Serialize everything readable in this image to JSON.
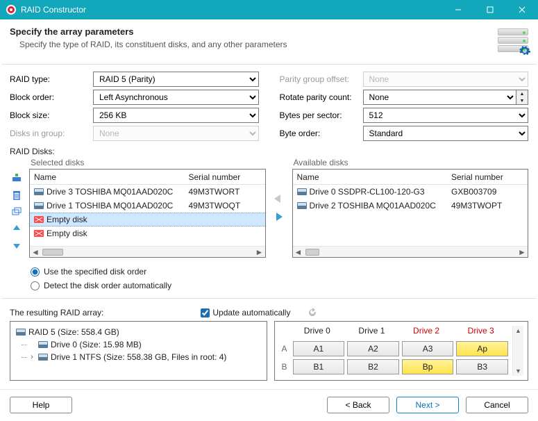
{
  "window": {
    "title": "RAID Constructor"
  },
  "header": {
    "title": "Specify the array parameters",
    "subtitle": "Specify the type of RAID, its constituent disks, and any other parameters"
  },
  "left_form": {
    "raid_type": {
      "label": "RAID type:",
      "value": "RAID 5 (Parity)"
    },
    "block_order": {
      "label": "Block order:",
      "value": "Left Asynchronous"
    },
    "block_size": {
      "label": "Block size:",
      "value": "256 KB"
    },
    "disks_in_group": {
      "label": "Disks in group:",
      "value": "None"
    }
  },
  "right_form": {
    "parity_offset": {
      "label": "Parity group offset:",
      "value": "None"
    },
    "rotate_parity": {
      "label": "Rotate parity count:",
      "value": "None"
    },
    "bytes_per_sector": {
      "label": "Bytes per sector:",
      "value": "512"
    },
    "byte_order": {
      "label": "Byte order:",
      "value": "Standard"
    }
  },
  "raid_disks_label": "RAID Disks:",
  "selected_group": "Selected disks",
  "available_group": "Available disks",
  "cols": {
    "name": "Name",
    "serial": "Serial number"
  },
  "selected": [
    {
      "name": "Drive 3 TOSHIBA MQ01AAD020C",
      "serial": "49M3TWORT",
      "empty": false
    },
    {
      "name": "Drive 1 TOSHIBA MQ01AAD020C",
      "serial": "49M3TWOQT",
      "empty": false
    },
    {
      "name": "Empty disk",
      "serial": "",
      "empty": true,
      "selected": true
    },
    {
      "name": "Empty disk",
      "serial": "",
      "empty": true
    }
  ],
  "available": [
    {
      "name": "Drive 0 SSDPR-CL100-120-G3",
      "serial": "GXB003709"
    },
    {
      "name": "Drive 2 TOSHIBA MQ01AAD020C",
      "serial": "49M3TWOPT"
    }
  ],
  "order": {
    "specified": "Use the specified disk order",
    "auto": "Detect the disk order automatically"
  },
  "result": {
    "label": "The resulting RAID array:",
    "update": "Update automatically",
    "tree": {
      "root": "RAID 5 (Size: 558.4 GB)",
      "c0": "Drive 0 (Size: 15.98 MB)",
      "c1": "Drive 1 NTFS (Size: 558.38 GB, Files in root: 4)"
    }
  },
  "matrix": {
    "headers": [
      "Drive 0",
      "Drive 1",
      "Drive 2",
      "Drive 3"
    ],
    "red": [
      false,
      false,
      true,
      true
    ],
    "rows": [
      {
        "label": "A",
        "cells": [
          "A1",
          "A2",
          "A3",
          "Ap"
        ],
        "hl": [
          false,
          false,
          false,
          true
        ]
      },
      {
        "label": "B",
        "cells": [
          "B1",
          "B2",
          "Bp",
          "B3"
        ],
        "hl": [
          false,
          false,
          true,
          false
        ]
      }
    ]
  },
  "footer": {
    "help": "Help",
    "back": "< Back",
    "next": "Next >",
    "cancel": "Cancel"
  }
}
